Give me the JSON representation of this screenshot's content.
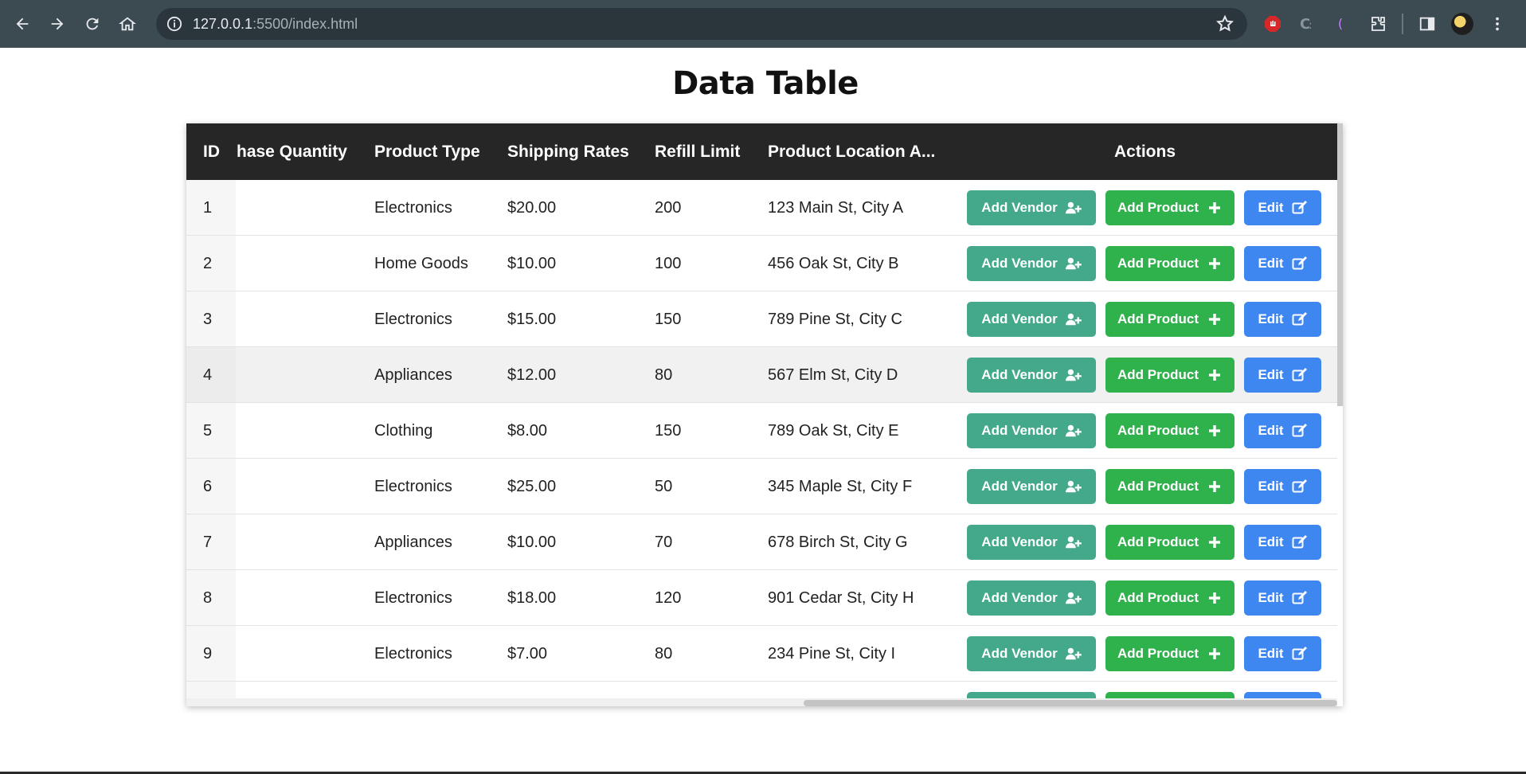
{
  "browser": {
    "url_host": "127.0.0.1",
    "url_path": ":5500/index.html"
  },
  "page": {
    "title": "Data Table"
  },
  "table": {
    "columns": [
      "ID",
      "hase Quantity",
      "Product Type",
      "Shipping Rates",
      "Refill Limit",
      "Product Location A...",
      "Actions"
    ],
    "rows": [
      {
        "id": "1",
        "quantity": "",
        "type": "Electronics",
        "rate": "$20.00",
        "limit": "200",
        "location": "123 Main St, City A"
      },
      {
        "id": "2",
        "quantity": "",
        "type": "Home Goods",
        "rate": "$10.00",
        "limit": "100",
        "location": "456 Oak St, City B"
      },
      {
        "id": "3",
        "quantity": "",
        "type": "Electronics",
        "rate": "$15.00",
        "limit": "150",
        "location": "789 Pine St, City C"
      },
      {
        "id": "4",
        "quantity": "",
        "type": "Appliances",
        "rate": "$12.00",
        "limit": "80",
        "location": "567 Elm St, City D"
      },
      {
        "id": "5",
        "quantity": "",
        "type": "Clothing",
        "rate": "$8.00",
        "limit": "150",
        "location": "789 Oak St, City E"
      },
      {
        "id": "6",
        "quantity": "",
        "type": "Electronics",
        "rate": "$25.00",
        "limit": "50",
        "location": "345 Maple St, City F"
      },
      {
        "id": "7",
        "quantity": "",
        "type": "Appliances",
        "rate": "$10.00",
        "limit": "70",
        "location": "678 Birch St, City G"
      },
      {
        "id": "8",
        "quantity": "",
        "type": "Electronics",
        "rate": "$18.00",
        "limit": "120",
        "location": "901 Cedar St, City H"
      },
      {
        "id": "9",
        "quantity": "",
        "type": "Electronics",
        "rate": "$7.00",
        "limit": "80",
        "location": "234 Pine St, City I"
      }
    ],
    "highlighted_row": "4",
    "actions": {
      "add_vendor": "Add Vendor",
      "add_product": "Add Product",
      "edit": "Edit"
    },
    "colors": {
      "header_bg": "#262626",
      "vendor_btn": "#44a98a",
      "product_btn": "#2fb24c",
      "edit_btn": "#3f87f0"
    }
  }
}
